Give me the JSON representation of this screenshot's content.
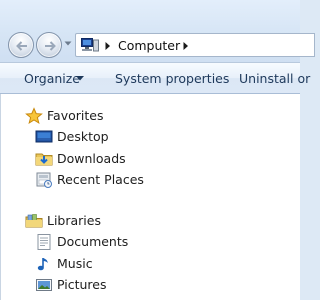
{
  "address_bar": {
    "location": "Computer"
  },
  "toolbar": {
    "organize_label": "Organize",
    "system_properties_label": "System properties",
    "uninstall_label": "Uninstall or"
  },
  "nav": {
    "favorites": {
      "label": "Favorites",
      "items": [
        {
          "label": "Desktop",
          "icon": "desktop-icon"
        },
        {
          "label": "Downloads",
          "icon": "downloads-folder-icon"
        },
        {
          "label": "Recent Places",
          "icon": "recent-places-icon"
        }
      ]
    },
    "libraries": {
      "label": "Libraries",
      "items": [
        {
          "label": "Documents",
          "icon": "documents-icon"
        },
        {
          "label": "Music",
          "icon": "music-icon"
        },
        {
          "label": "Pictures",
          "icon": "pictures-icon"
        }
      ]
    }
  },
  "colors": {
    "chrome_background": "#dde9f5",
    "toolbar_text": "#1e395b",
    "pane_background": "#ffffff"
  }
}
